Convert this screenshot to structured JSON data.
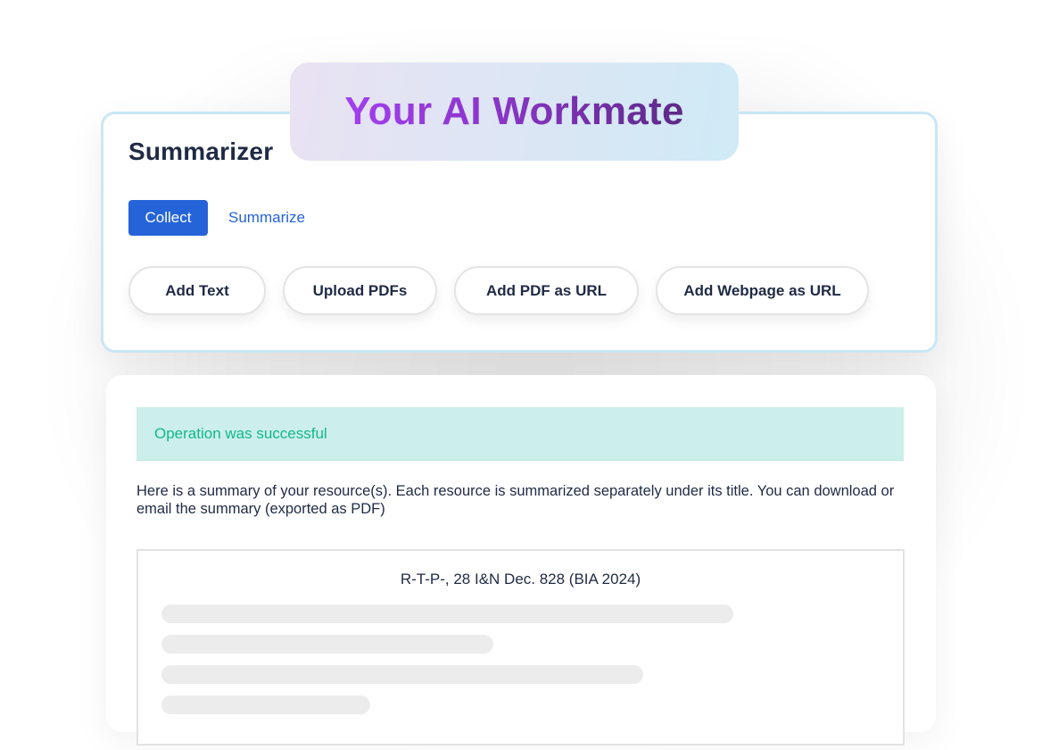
{
  "badge": {
    "text": "Your AI Workmate",
    "gradient_colors": [
      "#a33ff0",
      "#5d2a86"
    ]
  },
  "app": {
    "title": "Summarizer"
  },
  "tabs": [
    {
      "label": "Collect",
      "active": true
    },
    {
      "label": "Summarize",
      "active": false
    }
  ],
  "actions": [
    {
      "label": "Add Text"
    },
    {
      "label": "Upload PDFs"
    },
    {
      "label": "Add PDF as URL"
    },
    {
      "label": "Add Webpage as URL"
    }
  ],
  "result": {
    "alert": "Operation was successful",
    "intro": "Here is a summary of your resource(s). Each resource is summarized separately under its title. You can download or email the summary (exported as PDF)",
    "resource_title": "R-T-P-, 28 I&N Dec. 828 (BIA 2024)"
  },
  "colors": {
    "accent": "#2563d9",
    "success_bg": "#ccefeb",
    "success_text": "#12b886",
    "card_border": "#c9e7f5"
  }
}
